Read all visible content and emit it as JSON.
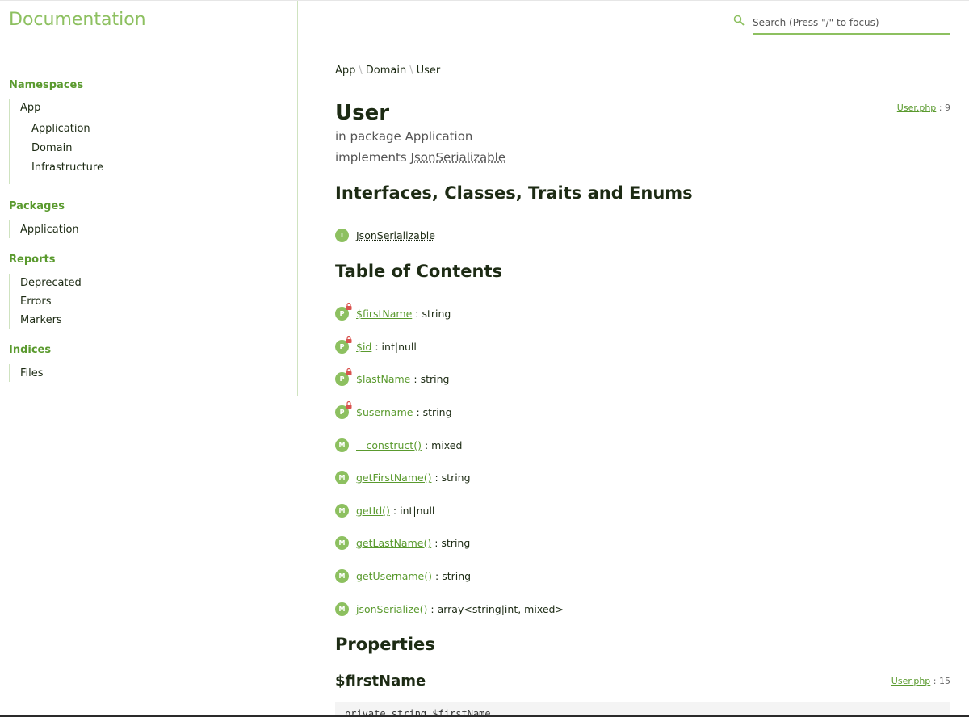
{
  "brand": "Documentation",
  "search": {
    "placeholder": "Search (Press \"/\" to focus)"
  },
  "sidebar": {
    "namespaces_title": "Namespaces",
    "namespaces": [
      "App",
      "Application",
      "Domain",
      "Infrastructure"
    ],
    "packages_title": "Packages",
    "packages": [
      "Application"
    ],
    "reports_title": "Reports",
    "reports": [
      "Deprecated",
      "Errors",
      "Markers"
    ],
    "indices_title": "Indices",
    "indices": [
      "Files"
    ]
  },
  "breadcrumb": [
    "App",
    "Domain",
    "User"
  ],
  "breadcrumb_sep": "\\",
  "page": {
    "title": "User",
    "package_prefix": "in package",
    "package": "Application",
    "implements_prefix": "implements",
    "implements": "JsonSerializable",
    "file": "User.php",
    "line": ": 9"
  },
  "interfaces_title": "Interfaces, Classes, Traits and Enums",
  "interfaces": [
    {
      "badge": "I",
      "name": "JsonSerializable"
    }
  ],
  "toc_title": "Table of Contents",
  "toc": [
    {
      "badge": "P",
      "name": "$firstName",
      "type": ": string"
    },
    {
      "badge": "P",
      "name": "$id",
      "type": ": int|null"
    },
    {
      "badge": "P",
      "name": "$lastName",
      "type": ": string"
    },
    {
      "badge": "P",
      "name": "$username",
      "type": ": string"
    },
    {
      "badge": "M",
      "name": "__construct()",
      "type": ": mixed"
    },
    {
      "badge": "M",
      "name": "getFirstName()",
      "type": ": string"
    },
    {
      "badge": "M",
      "name": "getId()",
      "type": ": int|null"
    },
    {
      "badge": "M",
      "name": "getLastName()",
      "type": ": string"
    },
    {
      "badge": "M",
      "name": "getUsername()",
      "type": ": string"
    },
    {
      "badge": "M",
      "name": "jsonSerialize()",
      "type": ": array<string|int, mixed>"
    }
  ],
  "properties_title": "Properties",
  "property": {
    "name": "$firstName",
    "file": "User.php",
    "line": ": 15",
    "code": "private string $firstName"
  },
  "colors": {
    "accent": "#8dc060",
    "link": "#5a9a2e",
    "text": "#1d2b14"
  },
  "icons": {
    "search": "search-icon",
    "lock": "lock-icon"
  }
}
